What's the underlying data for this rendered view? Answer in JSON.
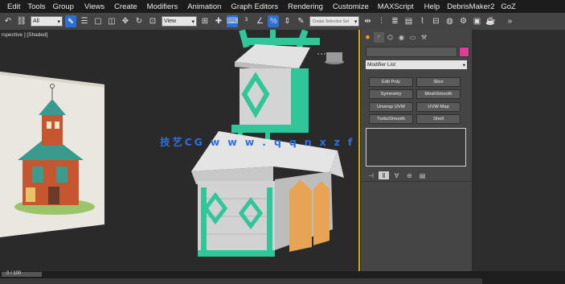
{
  "menubar": {
    "items": [
      "Edit",
      "Tools",
      "Group",
      "Views",
      "Create",
      "Modifiers",
      "Animation",
      "Graph Editors",
      "Rendering",
      "Customize",
      "MAXScript",
      "Help",
      "DebrisMaker2",
      "GoZ"
    ]
  },
  "toolbar": {
    "selection_filter": "All",
    "coord_system": "View",
    "named_selection_placeholder": "Create Selection Set"
  },
  "viewport": {
    "label": "rspective ] [Shaded]"
  },
  "command_panel": {
    "modifier_list_label": "Modifier List",
    "modifier_buttons": [
      "Edit Poly",
      "Slice",
      "Symmetry",
      "MeshSmooth",
      "Unwrap UVW",
      "UVW Map",
      "TurboSmooth",
      "Shell"
    ],
    "object_color": "#e43a9a"
  },
  "watermark": {
    "text": "技艺CG  w w w . q q n x z f b . c n"
  },
  "timeline": {
    "frame_text": "0 / 100"
  },
  "colors": {
    "selection_blue": "#2b6fd6",
    "viewport_border": "#d3a80a",
    "teal_trim": "#2fc79a"
  }
}
